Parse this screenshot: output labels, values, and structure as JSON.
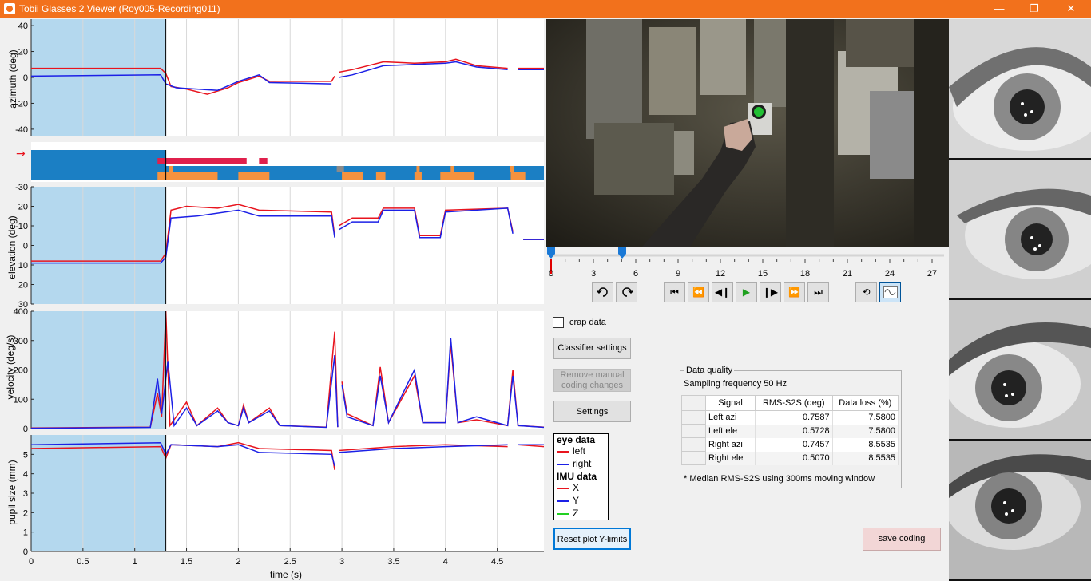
{
  "window": {
    "title": "Tobii Glasses 2 Viewer (Roy005-Recording011)",
    "minimize": "—",
    "maximize": "❐",
    "close": "✕"
  },
  "plots": {
    "azimuth": {
      "ylabel": "azimuth (deg)",
      "yticks": [
        "40",
        "20",
        "0",
        "-20",
        "-40"
      ]
    },
    "elevation": {
      "ylabel": "elevation (deg)",
      "yticks": [
        "-30",
        "-20",
        "-10",
        "0",
        "10",
        "20",
        "30"
      ]
    },
    "velocity": {
      "ylabel": "velocity (deg/s)",
      "yticks": [
        "400",
        "300",
        "200",
        "100",
        "0"
      ]
    },
    "pupil": {
      "ylabel": "pupil size (mm)",
      "yticks": [
        "5",
        "4",
        "3",
        "2",
        "1",
        "0"
      ]
    },
    "xlabel": "time (s)",
    "xticks": [
      "0",
      "0.5",
      "1",
      "1.5",
      "2",
      "2.5",
      "3",
      "3.5",
      "4",
      "4.5"
    ],
    "classification_marker": "→"
  },
  "colors": {
    "left": "#e8141e",
    "right": "#1c20e6",
    "X": "#e8141e",
    "Y": "#1c20e6",
    "Z": "#22d022",
    "shade": "#b4d8ee",
    "class_blue": "#1b7fc4",
    "class_orange": "#f5923e",
    "class_red": "#e0204c"
  },
  "scrubber": {
    "ticks": [
      "0",
      "3",
      "6",
      "9",
      "12",
      "15",
      "18",
      "21",
      "24",
      "27"
    ]
  },
  "controls": {
    "crap_data_label": "crap data",
    "crap_data_checked": false,
    "classifier_settings": "Classifier settings",
    "remove_manual_line1": "Remove manual",
    "remove_manual_line2": "coding changes",
    "settings": "Settings",
    "reset_plot": "Reset plot Y-limits",
    "save_coding": "save coding"
  },
  "media_buttons": {
    "undo": "undo-icon",
    "redo": "redo-icon",
    "first": "skip-start-icon",
    "rewind": "rewind-icon",
    "step_back": "step-back-icon",
    "play": "play-icon",
    "step_forward": "step-forward-icon",
    "fast_forward": "fast-forward-icon",
    "last": "skip-end-icon",
    "loop": "loop-icon",
    "signal": "signal-icon"
  },
  "legend": {
    "eye_heading": "eye data",
    "left": "left",
    "right": "right",
    "imu_heading": "IMU data",
    "x": "X",
    "y": "Y",
    "z": "Z"
  },
  "data_quality": {
    "caption": "Data quality",
    "sampling": "Sampling frequency 50 Hz",
    "headers": [
      "Signal",
      "RMS-S2S (deg)",
      "Data loss (%)"
    ],
    "rows": [
      {
        "signal": "Left azi",
        "rms": "0.7587",
        "loss": "7.5800"
      },
      {
        "signal": "Left ele",
        "rms": "0.5728",
        "loss": "7.5800"
      },
      {
        "signal": "Right azi",
        "rms": "0.7457",
        "loss": "8.5535"
      },
      {
        "signal": "Right ele",
        "rms": "0.5070",
        "loss": "8.5535"
      }
    ],
    "footnote": "* Median RMS-S2S using 300ms moving window"
  }
}
